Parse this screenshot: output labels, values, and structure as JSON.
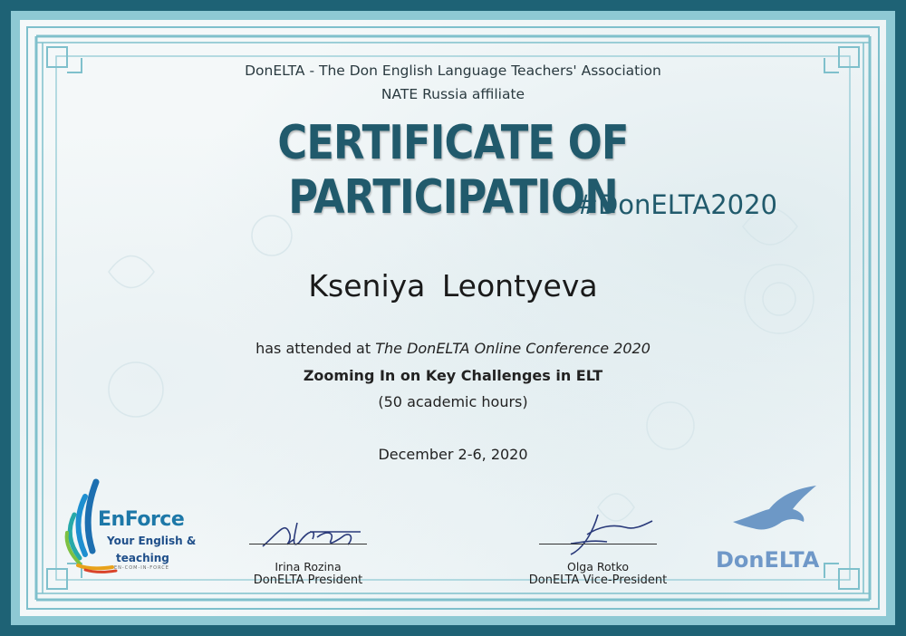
{
  "header": {
    "association": "DonELTA - The Don English Language Teachers' Association",
    "affiliate": "NATE Russia affiliate"
  },
  "title": "CERTIFICATE OF PARTICIPATION",
  "hashtag": "#DonELTA2020",
  "recipient": "Kseniya  Leontyeva",
  "body": {
    "attended_prefix": "has attended at ",
    "event": "The DonELTA Online Conference 2020",
    "topic": "Zooming In on Key Challenges in ELT",
    "hours": "(50 academic hours)",
    "dates": "December 2-6, 2020"
  },
  "signatures": [
    {
      "name": "Irina Rozina",
      "role": "DonELTA President"
    },
    {
      "name": "Olga Rotko",
      "role": "DonELTA Vice-President"
    }
  ],
  "logos": {
    "enforce": {
      "title": "EnForce",
      "line1": "Your English &",
      "line2": "teaching",
      "tiny": "EN-COM-IN-FORCE"
    },
    "donelta": {
      "text": "DonELTA"
    }
  },
  "colors": {
    "frame_dark": "#1e6275",
    "frame_light": "#8ec9d4",
    "title": "#215a6c",
    "paper": "#f4f8f9"
  }
}
